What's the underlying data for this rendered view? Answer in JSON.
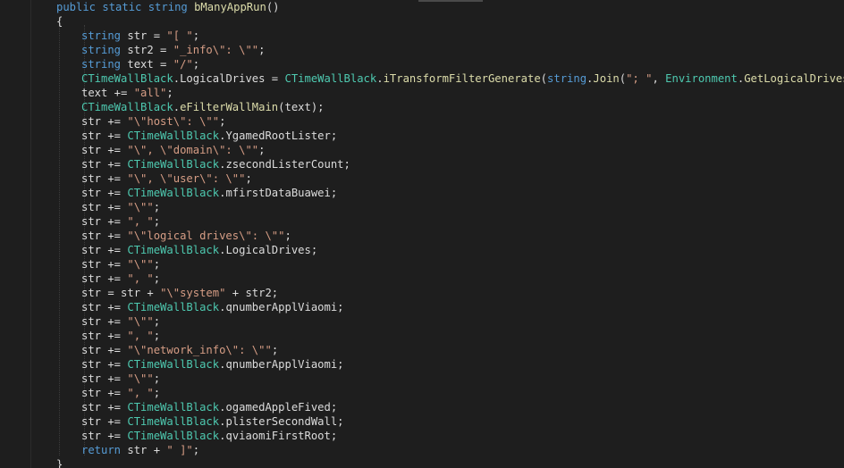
{
  "colors": {
    "background": "#1e1e1e",
    "keyword": "#569cd6",
    "type": "#4ec9b0",
    "method": "#dcdcaa",
    "string": "#d69d85",
    "plain": "#dcdcdc"
  },
  "code": {
    "lines": [
      [
        {
          "k": "kw",
          "t": "public static string "
        },
        {
          "k": "fn",
          "t": "bManyAppRun"
        },
        {
          "k": "pl",
          "t": "()"
        }
      ],
      [
        {
          "k": "pl",
          "t": "{"
        }
      ],
      [
        {
          "k": "kw",
          "t": "string"
        },
        {
          "k": "pl",
          "t": " str = "
        },
        {
          "k": "str",
          "t": "\"[ \""
        },
        {
          "k": "pl",
          "t": ";"
        }
      ],
      [
        {
          "k": "kw",
          "t": "string"
        },
        {
          "k": "pl",
          "t": " str2 = "
        },
        {
          "k": "str",
          "t": "\"_info\\\": \\\"\""
        },
        {
          "k": "pl",
          "t": ";"
        }
      ],
      [
        {
          "k": "kw",
          "t": "string"
        },
        {
          "k": "pl",
          "t": " text = "
        },
        {
          "k": "str",
          "t": "\"/\""
        },
        {
          "k": "pl",
          "t": ";"
        }
      ],
      [
        {
          "k": "ty",
          "t": "CTimeWallBlack"
        },
        {
          "k": "pl",
          "t": "."
        },
        {
          "k": "pl",
          "t": "LogicalDrives = "
        },
        {
          "k": "ty",
          "t": "CTimeWallBlack"
        },
        {
          "k": "pl",
          "t": "."
        },
        {
          "k": "mf",
          "t": "iTransformFilterGenerate"
        },
        {
          "k": "pl",
          "t": "("
        },
        {
          "k": "kw",
          "t": "string"
        },
        {
          "k": "pl",
          "t": "."
        },
        {
          "k": "mf",
          "t": "Join"
        },
        {
          "k": "pl",
          "t": "("
        },
        {
          "k": "str",
          "t": "\"; \""
        },
        {
          "k": "pl",
          "t": ", "
        },
        {
          "k": "ty",
          "t": "Environment"
        },
        {
          "k": "pl",
          "t": "."
        },
        {
          "k": "mf",
          "t": "GetLogicalDrives"
        },
        {
          "k": "pl",
          "t": "()));"
        }
      ],
      [
        {
          "k": "pl",
          "t": "text += "
        },
        {
          "k": "str",
          "t": "\"all\""
        },
        {
          "k": "pl",
          "t": ";"
        }
      ],
      [
        {
          "k": "ty",
          "t": "CTimeWallBlack"
        },
        {
          "k": "pl",
          "t": "."
        },
        {
          "k": "mf",
          "t": "eFilterWallMain"
        },
        {
          "k": "pl",
          "t": "(text);"
        }
      ],
      [
        {
          "k": "pl",
          "t": "str += "
        },
        {
          "k": "str",
          "t": "\"\\\"host\\\": \\\"\""
        },
        {
          "k": "pl",
          "t": ";"
        }
      ],
      [
        {
          "k": "pl",
          "t": "str += "
        },
        {
          "k": "ty",
          "t": "CTimeWallBlack"
        },
        {
          "k": "pl",
          "t": ".YgamedRootLister;"
        }
      ],
      [
        {
          "k": "pl",
          "t": "str += "
        },
        {
          "k": "str",
          "t": "\"\\\", \\\"domain\\\": \\\"\""
        },
        {
          "k": "pl",
          "t": ";"
        }
      ],
      [
        {
          "k": "pl",
          "t": "str += "
        },
        {
          "k": "ty",
          "t": "CTimeWallBlack"
        },
        {
          "k": "pl",
          "t": ".zsecondListerCount;"
        }
      ],
      [
        {
          "k": "pl",
          "t": "str += "
        },
        {
          "k": "str",
          "t": "\"\\\", \\\"user\\\": \\\"\""
        },
        {
          "k": "pl",
          "t": ";"
        }
      ],
      [
        {
          "k": "pl",
          "t": "str += "
        },
        {
          "k": "ty",
          "t": "CTimeWallBlack"
        },
        {
          "k": "pl",
          "t": ".mfirstDataBuawei;"
        }
      ],
      [
        {
          "k": "pl",
          "t": "str += "
        },
        {
          "k": "str",
          "t": "\"\\\"\""
        },
        {
          "k": "pl",
          "t": ";"
        }
      ],
      [
        {
          "k": "pl",
          "t": "str += "
        },
        {
          "k": "str",
          "t": "\", \""
        },
        {
          "k": "pl",
          "t": ";"
        }
      ],
      [
        {
          "k": "pl",
          "t": "str += "
        },
        {
          "k": "str",
          "t": "\"\\\"logical drives\\\": \\\"\""
        },
        {
          "k": "pl",
          "t": ";"
        }
      ],
      [
        {
          "k": "pl",
          "t": "str += "
        },
        {
          "k": "ty",
          "t": "CTimeWallBlack"
        },
        {
          "k": "pl",
          "t": ".LogicalDrives;"
        }
      ],
      [
        {
          "k": "pl",
          "t": "str += "
        },
        {
          "k": "str",
          "t": "\"\\\"\""
        },
        {
          "k": "pl",
          "t": ";"
        }
      ],
      [
        {
          "k": "pl",
          "t": "str += "
        },
        {
          "k": "str",
          "t": "\", \""
        },
        {
          "k": "pl",
          "t": ";"
        }
      ],
      [
        {
          "k": "pl",
          "t": "str = str + "
        },
        {
          "k": "str",
          "t": "\"\\\"system\""
        },
        {
          "k": "pl",
          "t": " + str2;"
        }
      ],
      [
        {
          "k": "pl",
          "t": "str += "
        },
        {
          "k": "ty",
          "t": "CTimeWallBlack"
        },
        {
          "k": "pl",
          "t": ".qnumberApplViaomi;"
        }
      ],
      [
        {
          "k": "pl",
          "t": "str += "
        },
        {
          "k": "str",
          "t": "\"\\\"\""
        },
        {
          "k": "pl",
          "t": ";"
        }
      ],
      [
        {
          "k": "pl",
          "t": "str += "
        },
        {
          "k": "str",
          "t": "\", \""
        },
        {
          "k": "pl",
          "t": ";"
        }
      ],
      [
        {
          "k": "pl",
          "t": "str += "
        },
        {
          "k": "str",
          "t": "\"\\\"network_info\\\": \\\"\""
        },
        {
          "k": "pl",
          "t": ";"
        }
      ],
      [
        {
          "k": "pl",
          "t": "str += "
        },
        {
          "k": "ty",
          "t": "CTimeWallBlack"
        },
        {
          "k": "pl",
          "t": ".qnumberApplViaomi;"
        }
      ],
      [
        {
          "k": "pl",
          "t": "str += "
        },
        {
          "k": "str",
          "t": "\"\\\"\""
        },
        {
          "k": "pl",
          "t": ";"
        }
      ],
      [
        {
          "k": "pl",
          "t": "str += "
        },
        {
          "k": "str",
          "t": "\", \""
        },
        {
          "k": "pl",
          "t": ";"
        }
      ],
      [
        {
          "k": "pl",
          "t": "str += "
        },
        {
          "k": "ty",
          "t": "CTimeWallBlack"
        },
        {
          "k": "pl",
          "t": ".ogamedAppleFived;"
        }
      ],
      [
        {
          "k": "pl",
          "t": "str += "
        },
        {
          "k": "ty",
          "t": "CTimeWallBlack"
        },
        {
          "k": "pl",
          "t": ".plisterSecondWall;"
        }
      ],
      [
        {
          "k": "pl",
          "t": "str += "
        },
        {
          "k": "ty",
          "t": "CTimeWallBlack"
        },
        {
          "k": "pl",
          "t": ".qviaomiFirstRoot;"
        }
      ],
      [
        {
          "k": "kw",
          "t": "return"
        },
        {
          "k": "pl",
          "t": " str + "
        },
        {
          "k": "str",
          "t": "\" ]\""
        },
        {
          "k": "pl",
          "t": ";"
        }
      ],
      [
        {
          "k": "pl",
          "t": "}"
        }
      ]
    ]
  }
}
